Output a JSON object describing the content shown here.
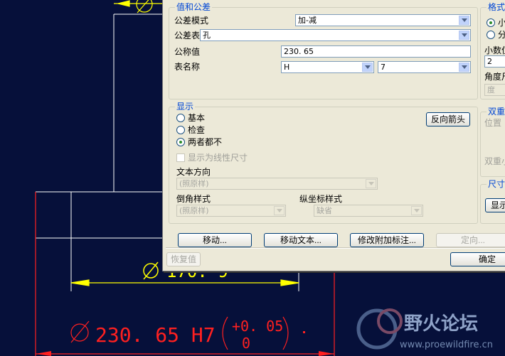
{
  "cad": {
    "dim_top_text": "Ø",
    "dim_mid_symbol": "Ø",
    "dim_mid_value": "170. 9",
    "dim_main_symbol": "Ø",
    "dim_main_value": "230. 65  H7",
    "tol_upper": "+0. 05",
    "tol_lower": "0"
  },
  "dialog": {
    "group_value": {
      "title": "值和公差",
      "tolerance_mode_label": "公差模式",
      "tolerance_mode_value": "加-减",
      "tolerance_table_label": "公差表",
      "tolerance_table_value": "孔",
      "nominal_label": "公称值",
      "nominal_value": "230. 65",
      "table_name_label": "表名称",
      "table_name_value_1": "H",
      "table_name_value_2": "7"
    },
    "group_format": {
      "title": "格式",
      "radio_1": "小",
      "radio_2": "分",
      "decimals_label": "小数位",
      "decimals_value": "2",
      "angle_label": "角度尺",
      "angle_value": "度"
    },
    "group_display": {
      "title": "显示",
      "radio_basic": "基本",
      "radio_inspect": "检查",
      "radio_neither": "两者都不",
      "reverse_arrow_button": "反向箭头",
      "linear_checkbox": "显示为线性尺寸",
      "text_direction_label": "文本方向",
      "text_direction_value": "(照原样)",
      "chamfer_label": "倒角样式",
      "chamfer_value": "(照原样)",
      "ordinate_label": "纵坐标样式",
      "ordinate_value": "缺省"
    },
    "group_dual": {
      "title": "双重",
      "position_label": "位置",
      "dual_label": "双重小"
    },
    "group_size": {
      "title": "尺寸",
      "button": "显示"
    },
    "buttons": {
      "move": "移动...",
      "move_text": "移动文本...",
      "modify_attached": "修改附加标注...",
      "orient": "定向...",
      "restore": "恢复值",
      "ok": "确定"
    }
  },
  "watermark": {
    "title": "野火论坛",
    "url": "www.proewildfire.cn"
  }
}
